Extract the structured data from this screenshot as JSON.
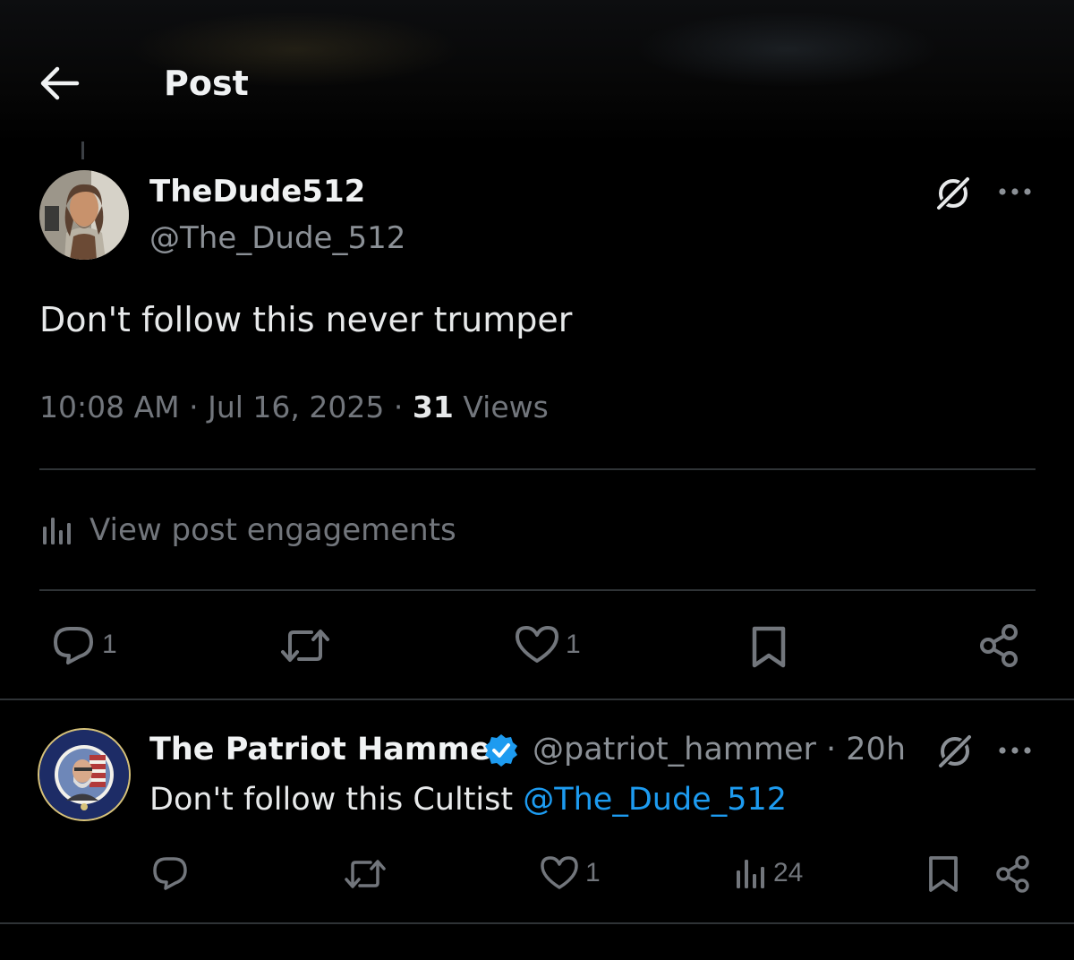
{
  "header": {
    "title": "Post",
    "back_icon": "arrow-left-icon"
  },
  "main_post": {
    "display_name": "TheDude512",
    "handle": "@The_Dude_512",
    "text": "Don't follow this never trumper",
    "time": "10:08 AM",
    "date": "Jul 16, 2025",
    "separator": " · ",
    "views_count": "31",
    "views_label": "Views",
    "engagements_label": "View post engagements",
    "actions": {
      "reply_count": "1",
      "like_count": "1"
    }
  },
  "reply": {
    "display_name": "The Patriot Hammer",
    "verified": true,
    "handle": "@patriot_hammer",
    "separator": " · ",
    "age": "20h",
    "text_prefix": "Don't follow this Cultist ",
    "mention": "@The_Dude_512",
    "actions": {
      "like_count": "1",
      "views_count": "24"
    }
  },
  "colors": {
    "background": "#000000",
    "text_primary": "#e7e9ea",
    "text_secondary": "#72767c",
    "link": "#1d9bf0",
    "divider": "#2f3336",
    "verified_badge": "#1d9bf0"
  }
}
